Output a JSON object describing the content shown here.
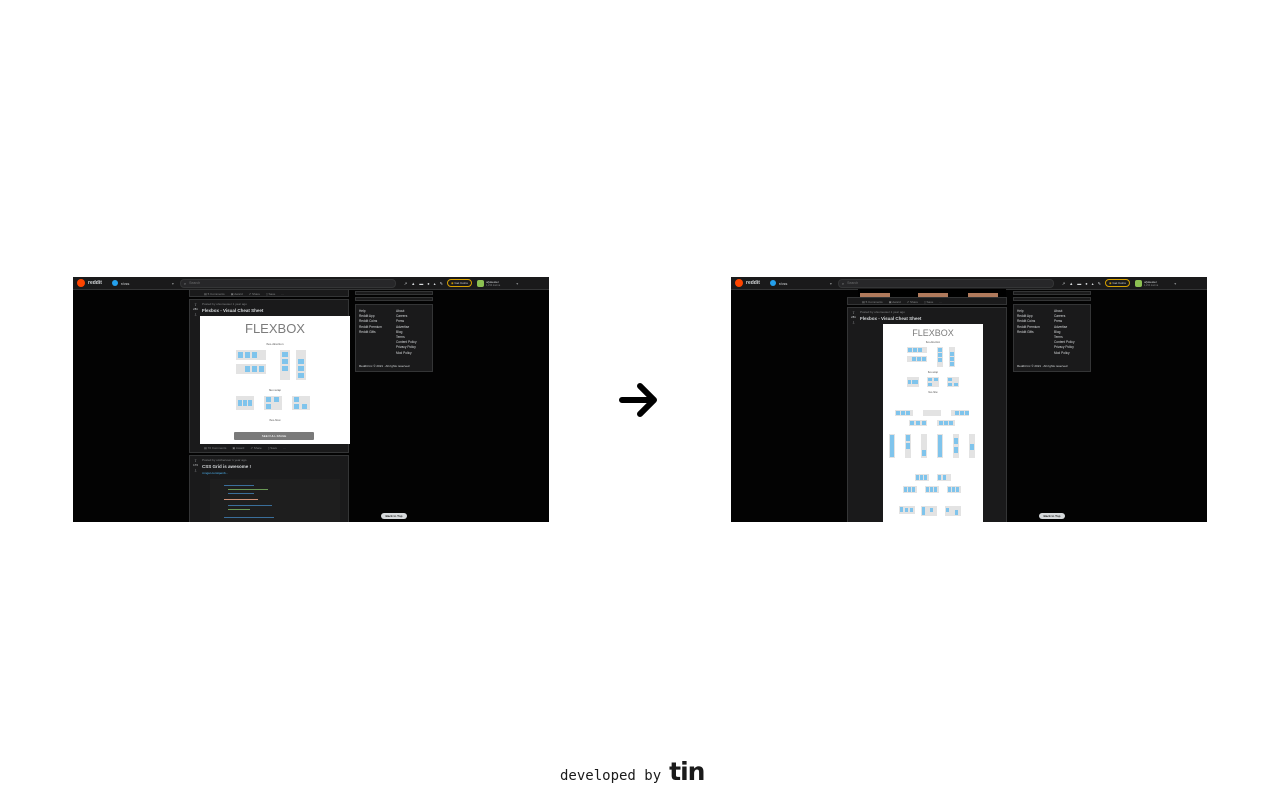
{
  "header": {
    "brand": "reddit",
    "subreddit": "r/css",
    "search_placeholder": "Search",
    "advise_label": "Get Coins",
    "username": "u/jokester",
    "karma": "1,234 karma"
  },
  "posts": {
    "prev_actions": [
      "5 Comments",
      "Award",
      "Share",
      "Save",
      "..."
    ],
    "flexbox": {
      "meta": "Posted by u/someuser 1 year ago",
      "title": "Flexbox - Visual Cheat Sheet",
      "image_title": "FLEXBOX",
      "row_direction": "flex-direction",
      "row_wrap": "flex-wrap",
      "row_flow": "flex-flow",
      "see_full": "SEE FULL IMAGE",
      "comments": "70 Comments",
      "actions": [
        "Award",
        "Share",
        "Save",
        "..."
      ],
      "votes": "281"
    },
    "grid": {
      "meta": "Posted by u/otheruser 1 year ago",
      "title": "CSS Grid is awesome !",
      "link": "i.imgur.com/qemb...",
      "votes": "173"
    }
  },
  "footer": {
    "col1": [
      "Help",
      "Reddit App",
      "Reddit Coins",
      "Reddit Premium",
      "Reddit Gifts"
    ],
    "col2": [
      "About",
      "Careers",
      "Press",
      "Advertise",
      "Blog",
      "Terms",
      "Content Policy",
      "Privacy Policy",
      "Mod Policy"
    ],
    "copyright": "Reddit Inc © 2021 . All rights reserved"
  },
  "back_to_top": "Back to Top",
  "credit": {
    "text": "developed by",
    "brand": "tin"
  },
  "colors": {
    "canvas": "#030303",
    "card": "#1a1a1b",
    "accent": "#ff4500",
    "flex_item": "#7fc4ec"
  }
}
